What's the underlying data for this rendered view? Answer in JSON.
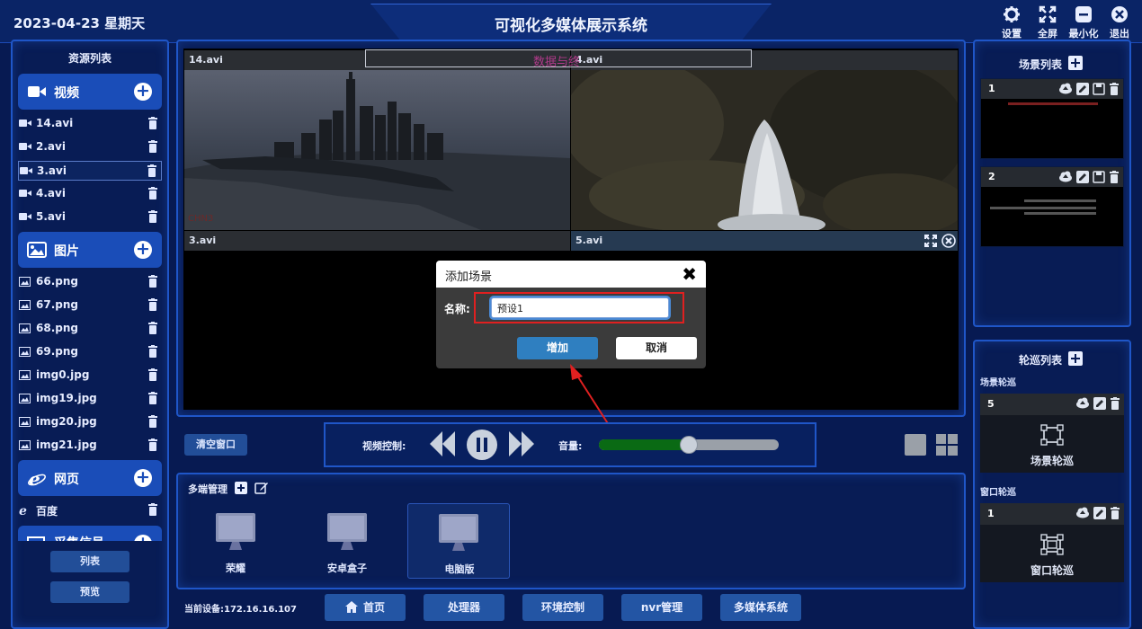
{
  "header": {
    "datetime": "2023-04-23   星期天",
    "title": "可视化多媒体展示系统",
    "buttons": [
      {
        "label": "设置",
        "icon": "gear-icon"
      },
      {
        "label": "全屏",
        "icon": "fullscreen-icon"
      },
      {
        "label": "最小化",
        "icon": "minimize-icon"
      },
      {
        "label": "退出",
        "icon": "exit-icon"
      }
    ]
  },
  "resources": {
    "title": "资源列表",
    "video_label": "视频",
    "videos": [
      "14.avi",
      "2.avi",
      "3.avi",
      "4.avi",
      "5.avi"
    ],
    "image_label": "图片",
    "images": [
      "66.png",
      "67.png",
      "68.png",
      "69.png",
      "img0.jpg",
      "img19.jpg",
      "img20.jpg",
      "img21.jpg"
    ],
    "web_label": "网页",
    "webs": [
      "百度"
    ],
    "capture_label": "采集信号",
    "list_button": "列表",
    "preview_button": "预览"
  },
  "screen": {
    "overlay_text": "数据与终",
    "cells": [
      "14.avi",
      "4.avi",
      "3.avi",
      "5.avi"
    ],
    "video_watermark": "CHN3"
  },
  "dialog": {
    "title": "添加场景",
    "name_label": "名称:",
    "name_value": "预设1",
    "add_button": "增加",
    "cancel_button": "取消"
  },
  "controls": {
    "clear_window": "清空窗口",
    "video_control_label": "视频控制:",
    "volume_label": "音量:",
    "volume_level": 0.5
  },
  "multi": {
    "title": "多端管理",
    "devices": [
      "荣耀",
      "安卓盒子",
      "电脑版"
    ],
    "selected": 2
  },
  "footer": {
    "current_device": "当前设备:172.16.16.107",
    "nav": [
      "首页",
      "处理器",
      "环境控制",
      "nvr管理",
      "多媒体系统"
    ]
  },
  "scenes": {
    "title": "场景列表",
    "items": [
      {
        "num": "1"
      },
      {
        "num": "2"
      }
    ]
  },
  "tours": {
    "title": "轮巡列表",
    "scene_tour_label": "场景轮巡",
    "scene_tour_num": "5",
    "scene_tour_name": "场景轮巡",
    "window_tour_label": "窗口轮巡",
    "window_tour_num": "1",
    "window_tour_name": "窗口轮巡"
  },
  "colors": {
    "background": "#071a52",
    "accent": "#1a4db8",
    "highlight_red": "#e02020",
    "volume_green": "#0a6a14"
  }
}
